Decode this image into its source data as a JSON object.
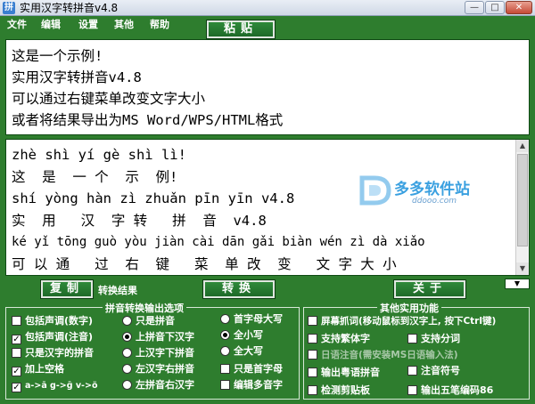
{
  "window": {
    "title": "实用汉字转拼音v4.8"
  },
  "menu": [
    "文件",
    "编辑",
    "设置",
    "其他",
    "帮助"
  ],
  "buttons": {
    "paste": "粘贴",
    "copy": "复制",
    "convert": "转换",
    "about": "关于"
  },
  "result_label": "转换结果",
  "input_lines": [
    "这是一个示例!",
    "实用汉字转拼音v4.8",
    "可以通过右键菜单改变文字大小",
    "或者将结果导出为MS Word/WPS/HTML格式"
  ],
  "output_lines": [
    "zhè shì yí gè shì lì!",
    "这  是  一 个  示  例!",
    "shí yòng hàn zì zhuǎn pīn yīn v4.8",
    "实  用   汉  字 转   拼  音  v4.8",
    "ké yǐ tōng guò yòu jiàn cài dān gǎi biàn wén zì dà xiǎo",
    "可 以 通   过  右  键   菜  单 改  变   文 字 大 小"
  ],
  "watermark": {
    "text": "多多软件站",
    "sub": "ddooo.com"
  },
  "pinyin_group": {
    "title": "拼音转换输出选项",
    "col1": [
      {
        "label": "包括声调(数字)",
        "checked": false
      },
      {
        "label": "包括声调(注音)",
        "checked": true
      },
      {
        "label": "只是汉字的拼音",
        "checked": false
      },
      {
        "label": "加上空格",
        "checked": true
      },
      {
        "label": "a->ā g->ḡ v->ö",
        "checked": true
      }
    ],
    "col2": [
      {
        "label": "只是拼音",
        "selected": false
      },
      {
        "label": "上拼音下汉字",
        "selected": true
      },
      {
        "label": "上汉字下拼音",
        "selected": false
      },
      {
        "label": "左汉字右拼音",
        "selected": false
      },
      {
        "label": "左拼音右汉字",
        "selected": false
      }
    ],
    "col3": [
      {
        "label": "首字母大写",
        "kind": "radio",
        "on": false
      },
      {
        "label": "全小写",
        "kind": "radio",
        "on": true
      },
      {
        "label": "全大写",
        "kind": "radio",
        "on": false
      },
      {
        "label": "只是首字母",
        "kind": "check",
        "on": false
      },
      {
        "label": "编辑多音字",
        "kind": "check",
        "on": false
      }
    ]
  },
  "other_group": {
    "title": "其他实用功能",
    "items": [
      {
        "label": "屏幕抓词(移动鼠标到汉字上, 按下Ctrl键)",
        "checked": false,
        "dim": false
      },
      {
        "label": "支持繁体字",
        "checked": false,
        "dim": false
      },
      {
        "label": "支持分词",
        "checked": false,
        "dim": false
      },
      {
        "label": "日语注音(需安装MS日语输入法)",
        "checked": false,
        "dim": true
      },
      {
        "label": "输出粤语拼音",
        "checked": false,
        "dim": false
      },
      {
        "label": "注音符号",
        "checked": false,
        "dim": false
      },
      {
        "label": "检测剪贴板",
        "checked": false,
        "dim": false
      },
      {
        "label": "输出五笔编码86",
        "checked": false,
        "dim": false
      }
    ]
  },
  "colors": {
    "background": "#2e7d2e",
    "button": "#1e6a28",
    "text_light": "#ffffff"
  }
}
